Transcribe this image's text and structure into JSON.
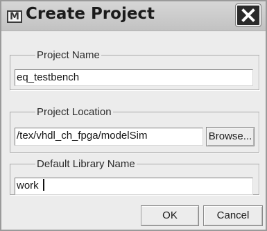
{
  "window": {
    "title": "Create Project",
    "icon": "modelsim-app-icon",
    "icon_glyph": "M",
    "close_icon": "close-icon"
  },
  "project_name": {
    "legend": "Project Name",
    "value": "eq_testbench"
  },
  "project_location": {
    "legend": "Project Location",
    "value": "/tex/vhdl_ch_fpga/modelSim",
    "browse_label": "Browse..."
  },
  "default_library": {
    "legend": "Default Library Name",
    "value": "work"
  },
  "buttons": {
    "ok_label": "OK",
    "cancel_label": "Cancel"
  },
  "colors": {
    "close_button_bg": "#2b2b2b",
    "titlebar_bg": "#c8c8c8",
    "dialog_bg": "#ececec"
  }
}
